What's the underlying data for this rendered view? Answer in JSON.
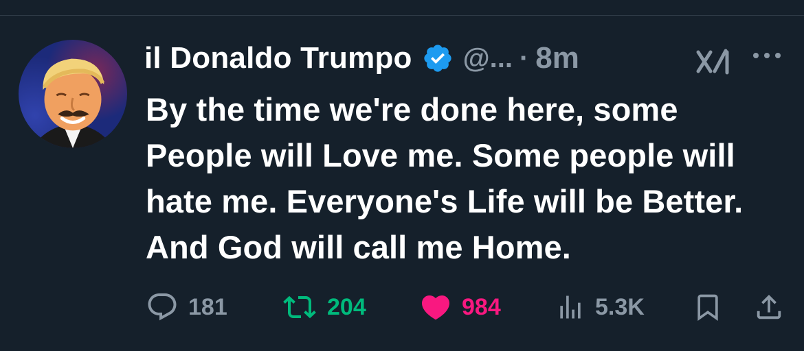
{
  "post": {
    "author_name": "il Donaldo Trumpo",
    "handle": "@...",
    "separator": "·",
    "time": "8m",
    "text": "By the time we're done here, some People will Love me. Some people will hate me. Everyone's Life will be Better. And God will call me Home."
  },
  "icons": {
    "verified": "verified-badge-icon",
    "grok": "grok-xai-icon",
    "more": "more-options-icon",
    "reply": "reply-icon",
    "retweet": "retweet-icon",
    "like": "heart-icon",
    "views": "views-icon",
    "bookmark": "bookmark-icon",
    "share": "share-icon"
  },
  "metrics": {
    "replies": "181",
    "reposts": "204",
    "likes": "984",
    "views": "5.3K"
  },
  "colors": {
    "background": "#15202b",
    "text": "#ffffff",
    "muted": "#8b98a5",
    "verified": "#1d9bf0",
    "repost": "#00ba7c",
    "like": "#f91880"
  }
}
